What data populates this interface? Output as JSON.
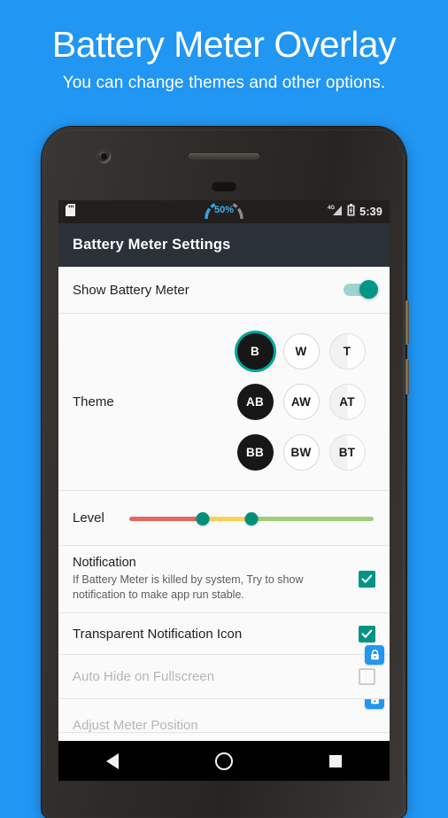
{
  "promo": {
    "title": "Battery Meter Overlay",
    "subtitle": "You can change  themes and other options.",
    "background_color": "#2196f3"
  },
  "phone": {
    "hardware": {
      "front_camera": "camera-icon",
      "speaker": "speaker-grille",
      "proximity_sensor": "sensor"
    },
    "side_buttons": [
      "power-button",
      "volume-button"
    ]
  },
  "statusbar": {
    "background_color": "#231f1e",
    "left_icons": [
      "sd-card-icon"
    ],
    "overlay_widget": {
      "label": "50%",
      "percent": 50,
      "accent_color": "#30a8e8",
      "inactive_color": "#6f6f6f"
    },
    "right_icons": [
      "4g-signal-icon",
      "battery-icon"
    ],
    "signal_label": "4G",
    "time": "5:39"
  },
  "appbar": {
    "title": "Battery Meter Settings",
    "background_color": "#2b3138"
  },
  "settings": {
    "show_battery_meter": {
      "label": "Show Battery Meter",
      "switch_on": true,
      "accent_color": "#009688"
    },
    "theme": {
      "label": "Theme",
      "selected": "B",
      "selected_ring_color": "#00a896",
      "swatches": [
        {
          "code": "B",
          "style": "dark"
        },
        {
          "code": "W",
          "style": "light"
        },
        {
          "code": "T",
          "style": "trans"
        },
        {
          "code": "AB",
          "style": "dark"
        },
        {
          "code": "AW",
          "style": "light"
        },
        {
          "code": "AT",
          "style": "trans"
        },
        {
          "code": "BB",
          "style": "dark"
        },
        {
          "code": "BW",
          "style": "light"
        },
        {
          "code": "BT",
          "style": "trans"
        }
      ]
    },
    "level": {
      "label": "Level",
      "low_value": 30,
      "mid_value": 50,
      "segment_colors": {
        "low": "#e4665f",
        "mid": "#fbd05a",
        "high": "#9fcf79"
      },
      "thumb_color": "#009079"
    },
    "notification": {
      "title": "Notification",
      "description": "If Battery Meter is killed by system, Try to show notification to make app run stable.",
      "checked": true
    },
    "transparent_icon": {
      "label": "Transparent Notification Icon",
      "checked": true
    },
    "auto_hide": {
      "label": "Auto Hide on Fullscreen",
      "checked": false,
      "locked": true,
      "lock_badge_color": "#2196f3"
    },
    "adjust_position": {
      "label": "Adjust Meter Position",
      "locked": true,
      "lock_badge_color": "#2196f3"
    }
  },
  "navbar": {
    "buttons": [
      "back-button",
      "home-button",
      "recents-button"
    ],
    "background_color": "#000000"
  }
}
